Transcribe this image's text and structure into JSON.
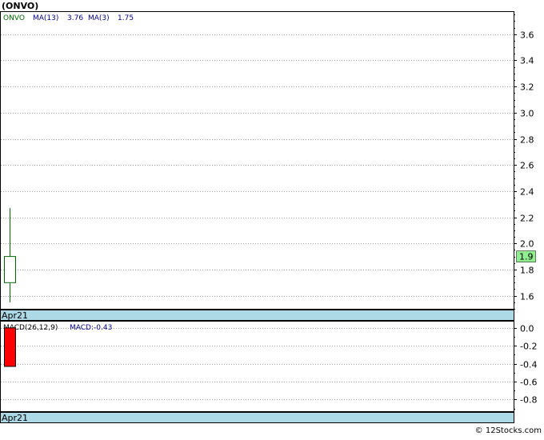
{
  "title": "(ONVO)",
  "watermark": "© 12Stocks.com",
  "colors": {
    "grid": "#a0a0a0",
    "axis": "#000000",
    "candle_up": "#ffffff",
    "candle_outline": "#006400",
    "price_label_bg": "#90ee90",
    "date_band": "#add8e6",
    "macd_bar": "#ff0000",
    "legend_ticker": "#006400",
    "legend_ma": "#00008b"
  },
  "chart_data": [
    {
      "type": "candlestick",
      "panel": "price",
      "legend": [
        {
          "text": "ONVO",
          "role": "ticker"
        },
        {
          "text": "MA(13)",
          "role": "ma"
        },
        {
          "text": "3.76",
          "role": "ma"
        },
        {
          "text": "MA(3)",
          "role": "ma"
        },
        {
          "text": "1.75",
          "role": "ma"
        }
      ],
      "ylim": [
        1.5,
        3.77
      ],
      "yticks": [
        1.6,
        1.8,
        2.0,
        2.2,
        2.4,
        2.6,
        2.8,
        3.0,
        3.2,
        3.4,
        3.6
      ],
      "ytick_labels": [
        "1.6",
        "1.8",
        "2.0",
        "2.2",
        "2.4",
        "2.6",
        "2.8",
        "3.0",
        "3.2",
        "3.4",
        "3.6"
      ],
      "candles": [
        {
          "date": "Apr21",
          "open": 1.7,
          "high": 2.27,
          "low": 1.55,
          "close": 1.9
        }
      ],
      "last_price_label": "1.9",
      "last_price": 1.9,
      "xlabel": "Apr21"
    },
    {
      "type": "bar",
      "panel": "macd",
      "legend": [
        {
          "text": "MACD(26,12,9)",
          "role": "name"
        },
        {
          "text": "MACD:-0.43",
          "role": "value"
        }
      ],
      "ylim": [
        -0.93,
        0.07
      ],
      "yticks": [
        0.0,
        -0.2,
        -0.4,
        -0.6,
        -0.8
      ],
      "ytick_labels": [
        "0.0",
        "-0.2",
        "-0.4",
        "-0.6",
        "-0.8"
      ],
      "categories": [
        "Apr21"
      ],
      "values": [
        -0.43
      ],
      "xlabel": "Apr21"
    }
  ]
}
